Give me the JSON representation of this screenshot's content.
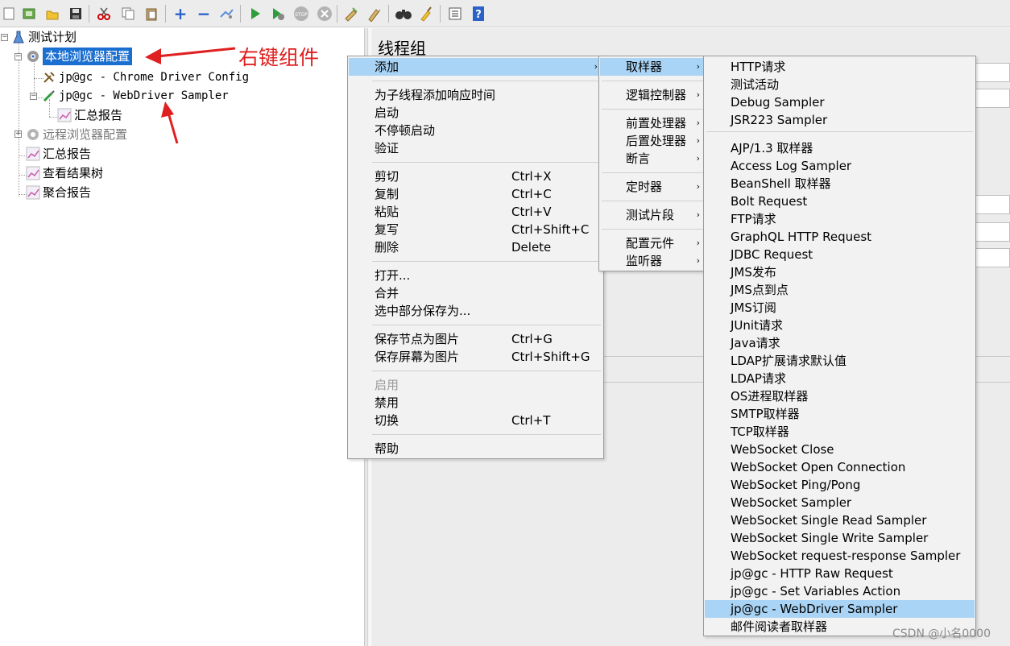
{
  "toolbar": {
    "icons": [
      "new-icon",
      "templates-icon",
      "open-icon",
      "save-icon",
      "cut-icon",
      "copy-icon",
      "paste-icon",
      "expand-icon",
      "collapse-icon",
      "toggle-icon",
      "start-icon",
      "start-no-pause-icon",
      "stop-icon",
      "shutdown-icon",
      "clear-icon",
      "clear-all-icon",
      "search-icon",
      "reset-search-icon",
      "function-helper-icon",
      "help-icon"
    ]
  },
  "tree": {
    "root": "测试计划",
    "items": [
      {
        "label": "本地浏览器配置",
        "selected": true
      },
      {
        "label": "jp@gc - Chrome Driver Config"
      },
      {
        "label": "jp@gc - WebDriver Sampler"
      },
      {
        "label": "汇总报告"
      },
      {
        "label": "远程浏览器配置",
        "disabled": true
      },
      {
        "label": "汇总报告"
      },
      {
        "label": "查看结果树"
      },
      {
        "label": "聚合报告"
      }
    ]
  },
  "annotation": {
    "text": "右键组件",
    "color": "#e02020"
  },
  "panel": {
    "title": "线程组"
  },
  "context_menu": {
    "items": [
      {
        "label": "添加",
        "submenu": true,
        "highlighted": true
      },
      {
        "label": "为子线程添加响应时间"
      },
      {
        "label": "启动"
      },
      {
        "label": "不停顿启动"
      },
      {
        "label": "验证"
      },
      {
        "label": "剪切",
        "shortcut": "Ctrl+X"
      },
      {
        "label": "复制",
        "shortcut": "Ctrl+C"
      },
      {
        "label": "粘贴",
        "shortcut": "Ctrl+V"
      },
      {
        "label": "复写",
        "shortcut": "Ctrl+Shift+C"
      },
      {
        "label": "删除",
        "shortcut": "Delete"
      },
      {
        "label": "打开..."
      },
      {
        "label": "合并"
      },
      {
        "label": "选中部分保存为..."
      },
      {
        "label": "保存节点为图片",
        "shortcut": "Ctrl+G"
      },
      {
        "label": "保存屏幕为图片",
        "shortcut": "Ctrl+Shift+G"
      },
      {
        "label": "启用",
        "disabled": true
      },
      {
        "label": "禁用"
      },
      {
        "label": "切换",
        "shortcut": "Ctrl+T"
      },
      {
        "label": "帮助"
      }
    ]
  },
  "add_menu": {
    "items": [
      {
        "label": "取样器",
        "highlighted": true
      },
      {
        "label": "逻辑控制器"
      },
      {
        "label": "前置处理器"
      },
      {
        "label": "后置处理器"
      },
      {
        "label": "断言"
      },
      {
        "label": "定时器"
      },
      {
        "label": "测试片段"
      },
      {
        "label": "配置元件"
      },
      {
        "label": "监听器"
      }
    ]
  },
  "sampler_menu": {
    "items": [
      "HTTP请求",
      "测试活动",
      "Debug Sampler",
      "JSR223 Sampler",
      "AJP/1.3 取样器",
      "Access Log Sampler",
      "BeanShell 取样器",
      "Bolt Request",
      "FTP请求",
      "GraphQL HTTP Request",
      "JDBC Request",
      "JMS发布",
      "JMS点到点",
      "JMS订阅",
      "JUnit请求",
      "Java请求",
      "LDAP扩展请求默认值",
      "LDAP请求",
      "OS进程取样器",
      "SMTP取样器",
      "TCP取样器",
      "WebSocket Close",
      "WebSocket Open Connection",
      "WebSocket Ping/Pong",
      "WebSocket Sampler",
      "WebSocket Single Read Sampler",
      "WebSocket Single Write Sampler",
      "WebSocket request-response Sampler",
      "jp@gc - HTTP Raw Request",
      "jp@gc - Set Variables Action",
      "jp@gc - WebDriver Sampler",
      "邮件阅读者取样器"
    ],
    "highlighted": "jp@gc - WebDriver Sampler"
  },
  "watermark": "CSDN @小名0000"
}
